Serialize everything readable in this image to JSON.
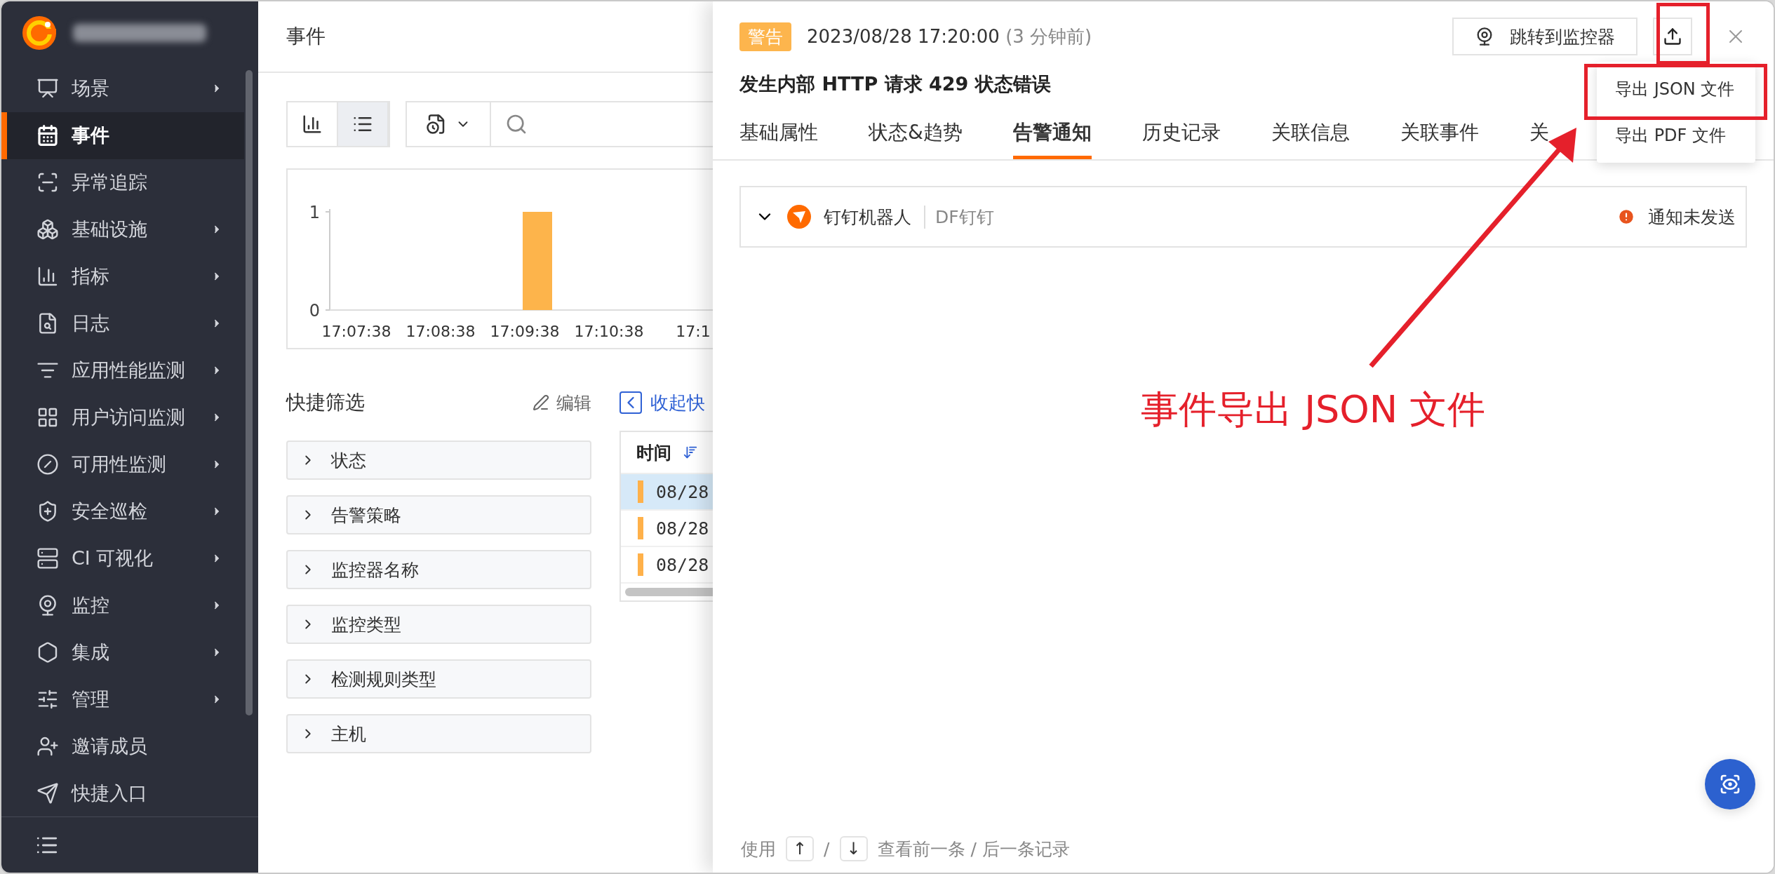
{
  "sidebar": {
    "items": [
      {
        "label": "场景",
        "selected": false,
        "expandable": true
      },
      {
        "label": "事件",
        "selected": true,
        "expandable": false
      },
      {
        "label": "异常追踪",
        "selected": false,
        "expandable": false
      },
      {
        "label": "基础设施",
        "selected": false,
        "expandable": true
      },
      {
        "label": "指标",
        "selected": false,
        "expandable": true
      },
      {
        "label": "日志",
        "selected": false,
        "expandable": true
      },
      {
        "label": "应用性能监测",
        "selected": false,
        "expandable": true
      },
      {
        "label": "用户访问监测",
        "selected": false,
        "expandable": true
      },
      {
        "label": "可用性监测",
        "selected": false,
        "expandable": true
      },
      {
        "label": "安全巡检",
        "selected": false,
        "expandable": true
      },
      {
        "label": "CI 可视化",
        "selected": false,
        "expandable": true
      },
      {
        "label": "监控",
        "selected": false,
        "expandable": true
      },
      {
        "label": "集成",
        "selected": false,
        "expandable": true
      },
      {
        "label": "管理",
        "selected": false,
        "expandable": true
      },
      {
        "label": "邀请成员",
        "selected": false,
        "expandable": false
      },
      {
        "label": "快捷入口",
        "selected": false,
        "expandable": false
      }
    ]
  },
  "page": {
    "title": "事件",
    "view_toggle": [
      {
        "kind": "chart",
        "selected": false
      },
      {
        "kind": "list",
        "selected": true
      }
    ],
    "chart": {
      "chart_data": {
        "type": "bar",
        "categories": [
          "17:07:38",
          "17:08:38",
          "17:09:38",
          "17:10:38",
          "17:1"
        ],
        "values": [
          0,
          0,
          1,
          0,
          0
        ],
        "yticks": [
          0,
          1
        ],
        "ylim": [
          0,
          1
        ]
      }
    },
    "quick_filter": {
      "title": "快捷筛选",
      "edit_label": "编辑",
      "items": [
        "状态",
        "告警策略",
        "监控器名称",
        "监控类型",
        "检测规则类型",
        "主机"
      ]
    },
    "collapse_link": "收起快",
    "table": {
      "column": "时间",
      "rows": [
        {
          "time": "08/28",
          "selected": true
        },
        {
          "time": "08/28",
          "selected": false
        },
        {
          "time": "08/28",
          "selected": false
        }
      ]
    }
  },
  "drawer": {
    "severity": "警告",
    "time": "2023/08/28 17:20:00",
    "relative_time": "(3 分钟前)",
    "jump_button": "跳转到监控器",
    "title": "发生内部 HTTP 请求 429 状态错误",
    "tabs": [
      {
        "label": "基础属性",
        "selected": false
      },
      {
        "label": "状态&趋势",
        "selected": false
      },
      {
        "label": "告警通知",
        "selected": true
      },
      {
        "label": "历史记录",
        "selected": false
      },
      {
        "label": "关联信息",
        "selected": false
      },
      {
        "label": "关联事件",
        "selected": false
      },
      {
        "label": "关",
        "selected": false
      }
    ],
    "export_menu": {
      "items": [
        "导出 JSON 文件",
        "导出 PDF 文件"
      ]
    },
    "notifications": [
      {
        "name": "钉钉机器人",
        "type": "DF钉钉",
        "status": "通知未发送"
      }
    ],
    "footer": {
      "prefix": "使用",
      "keys": [
        "↑",
        "↓"
      ],
      "separator": "/",
      "suffix": "查看前一条 / 后一条记录"
    }
  },
  "annotation": {
    "text": "事件导出 JSON 文件"
  }
}
